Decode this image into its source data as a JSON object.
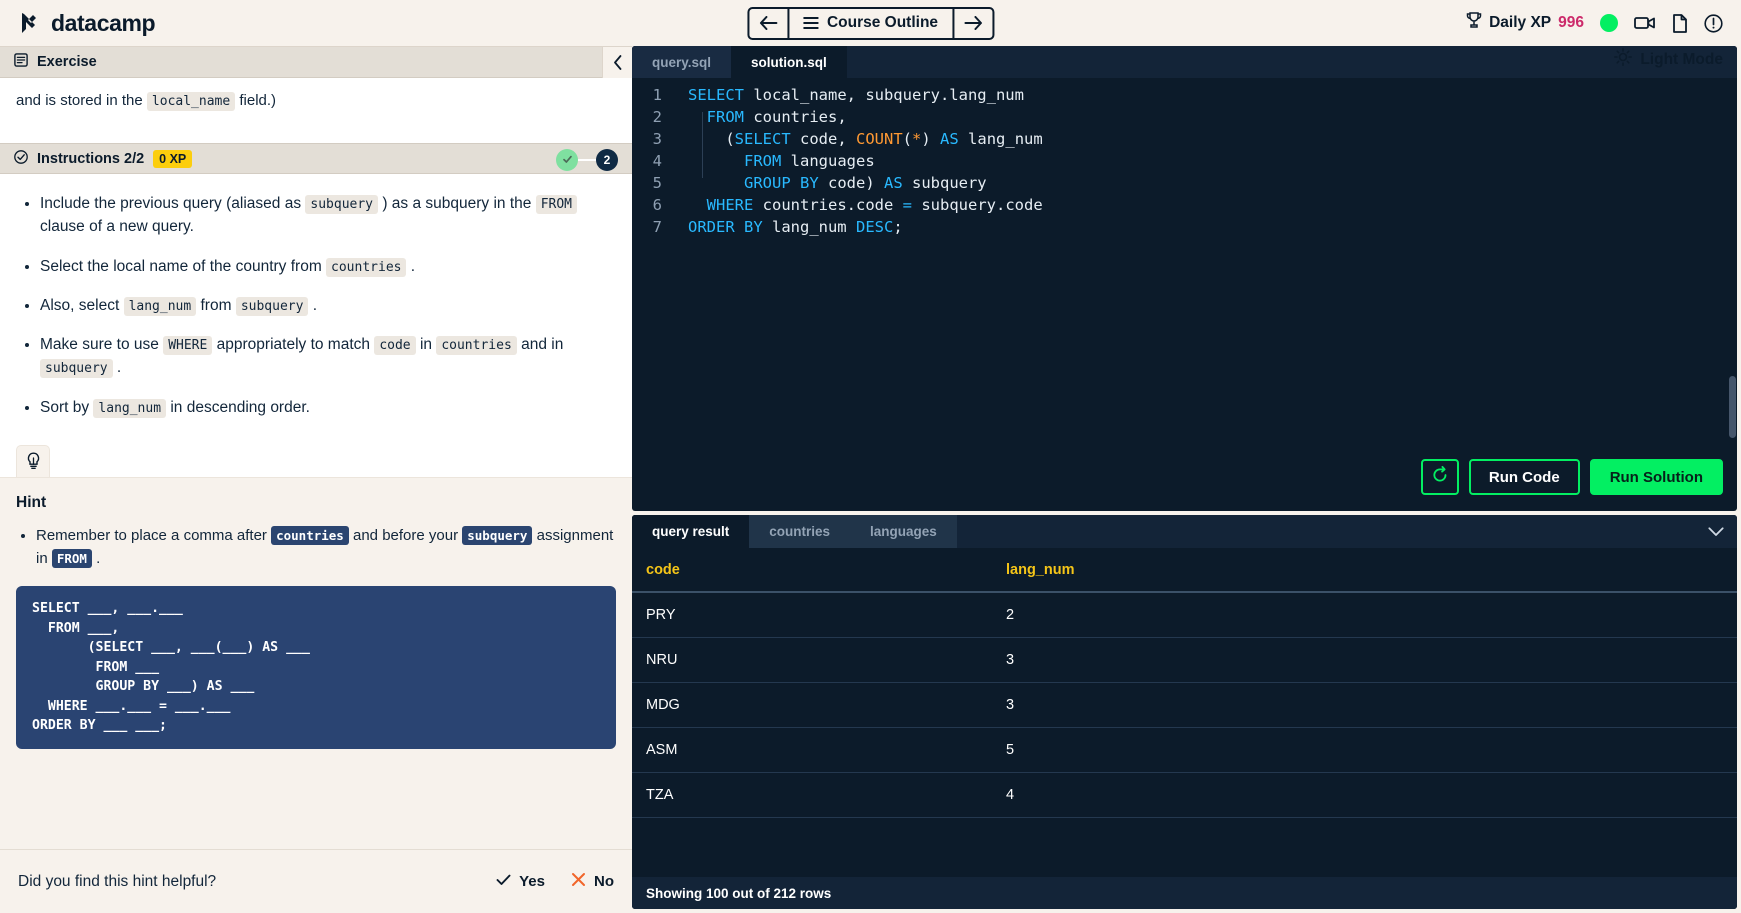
{
  "topbar": {
    "brand": "datacamp",
    "back_label": "back-arrow",
    "outline_label": "Course Outline",
    "forward_label": "forward-arrow",
    "xp_label": "Daily XP",
    "xp_value": "996",
    "icons": [
      "video-camera-icon",
      "document-icon",
      "info-circle-icon"
    ],
    "accent_green": "#03ef62",
    "xp_color": "#cc2a6a"
  },
  "light_mode": {
    "label": "Light Mode"
  },
  "exercise": {
    "header": "Exercise",
    "body_pre": "and is stored in the",
    "body_code": "local_name",
    "body_post": "field.)"
  },
  "instructions": {
    "header": "Instructions 2/2",
    "xp_badge": "0 XP",
    "steps": [
      {
        "state": "done",
        "label": ""
      },
      {
        "state": "current",
        "label": "2"
      }
    ],
    "items": [
      {
        "parts": [
          {
            "t": "text",
            "v": "Include the previous query (aliased as "
          },
          {
            "t": "code",
            "v": "subquery"
          },
          {
            "t": "text",
            "v": " ) as a subquery in the "
          },
          {
            "t": "code",
            "v": "FROM"
          },
          {
            "t": "text",
            "v": " clause of a new query."
          }
        ]
      },
      {
        "parts": [
          {
            "t": "text",
            "v": "Select the local name of the country from "
          },
          {
            "t": "code",
            "v": "countries"
          },
          {
            "t": "text",
            "v": " ."
          }
        ]
      },
      {
        "parts": [
          {
            "t": "text",
            "v": "Also, select "
          },
          {
            "t": "code",
            "v": "lang_num"
          },
          {
            "t": "text",
            "v": " from "
          },
          {
            "t": "code",
            "v": "subquery"
          },
          {
            "t": "text",
            "v": " ."
          }
        ]
      },
      {
        "parts": [
          {
            "t": "text",
            "v": "Make sure to use "
          },
          {
            "t": "code",
            "v": "WHERE"
          },
          {
            "t": "text",
            "v": " appropriately to match "
          },
          {
            "t": "code",
            "v": "code"
          },
          {
            "t": "text",
            "v": " in "
          },
          {
            "t": "code",
            "v": "countries"
          },
          {
            "t": "text",
            "v": " and in "
          },
          {
            "t": "code",
            "v": "subquery"
          },
          {
            "t": "text",
            "v": " ."
          }
        ]
      },
      {
        "parts": [
          {
            "t": "text",
            "v": "Sort by "
          },
          {
            "t": "code",
            "v": "lang_num"
          },
          {
            "t": "text",
            "v": " in descending order."
          }
        ]
      }
    ]
  },
  "hint": {
    "tab_icon": "lightbulb-icon",
    "title": "Hint",
    "items": [
      {
        "parts": [
          {
            "t": "text",
            "v": "Remember to place a comma after "
          },
          {
            "t": "dcode",
            "v": "countries"
          },
          {
            "t": "text",
            "v": " and before your "
          },
          {
            "t": "dcode",
            "v": "subquery"
          },
          {
            "t": "text",
            "v": " assignment in "
          },
          {
            "t": "dcode",
            "v": "FROM"
          },
          {
            "t": "text",
            "v": " ."
          }
        ]
      }
    ],
    "code_block": "SELECT ___, ___.___\n  FROM ___,\n       (SELECT ___, ___(___) AS ___\n        FROM ___\n        GROUP BY ___) AS ___\n  WHERE ___.___ = ___.___\nORDER BY ___ ___;",
    "feedback_question": "Did you find this hint helpful?",
    "yes_label": "Yes",
    "no_label": "No"
  },
  "editor": {
    "tabs": [
      {
        "label": "query.sql",
        "active": false
      },
      {
        "label": "solution.sql",
        "active": true
      }
    ],
    "line_numbers": [
      "1",
      "2",
      "3",
      "4",
      "5",
      "6",
      "7"
    ],
    "lines": [
      "SELECT local_name, subquery.lang_num",
      "  FROM countries,",
      "    (SELECT code, COUNT(*) AS lang_num",
      "      FROM languages",
      "      GROUP BY code) AS subquery",
      "  WHERE countries.code = subquery.code",
      "ORDER BY lang_num DESC;"
    ],
    "reset_label": "reset-icon",
    "run_code_label": "Run Code",
    "run_solution_label": "Run Solution"
  },
  "results": {
    "tabs": [
      {
        "label": "query result",
        "active": true
      },
      {
        "label": "countries",
        "active": false
      },
      {
        "label": "languages",
        "active": false
      }
    ],
    "columns": [
      "code",
      "lang_num"
    ],
    "rows": [
      [
        "PRY",
        "2"
      ],
      [
        "NRU",
        "3"
      ],
      [
        "MDG",
        "3"
      ],
      [
        "ASM",
        "5"
      ],
      [
        "TZA",
        "4"
      ]
    ],
    "footer": "Showing 100 out of 212 rows"
  }
}
